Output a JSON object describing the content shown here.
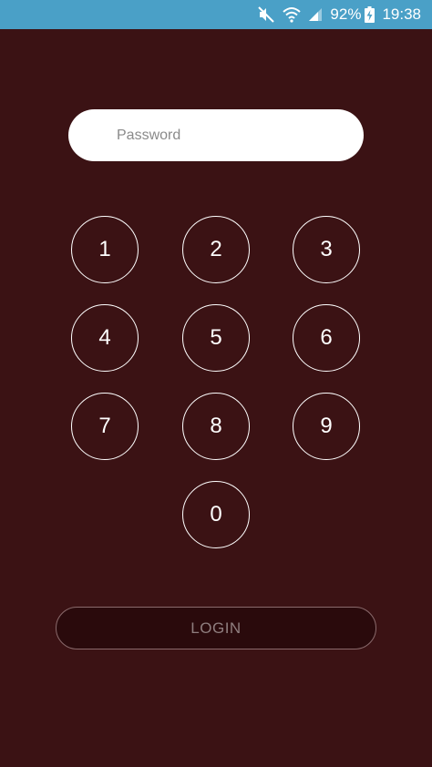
{
  "status_bar": {
    "battery_percent": "92%",
    "time": "19:38",
    "icons": [
      "mute-icon",
      "wifi-icon",
      "signal-icon",
      "battery-charging-icon"
    ]
  },
  "password": {
    "placeholder": "Password",
    "value": ""
  },
  "keypad": {
    "keys": [
      "1",
      "2",
      "3",
      "4",
      "5",
      "6",
      "7",
      "8",
      "9",
      "0"
    ]
  },
  "login": {
    "label": "LOGIN"
  },
  "colors": {
    "background": "#3b1214",
    "status_bar": "#4aa0c7",
    "button_fill": "#2a0a0c",
    "key_border": "#ffffff"
  }
}
